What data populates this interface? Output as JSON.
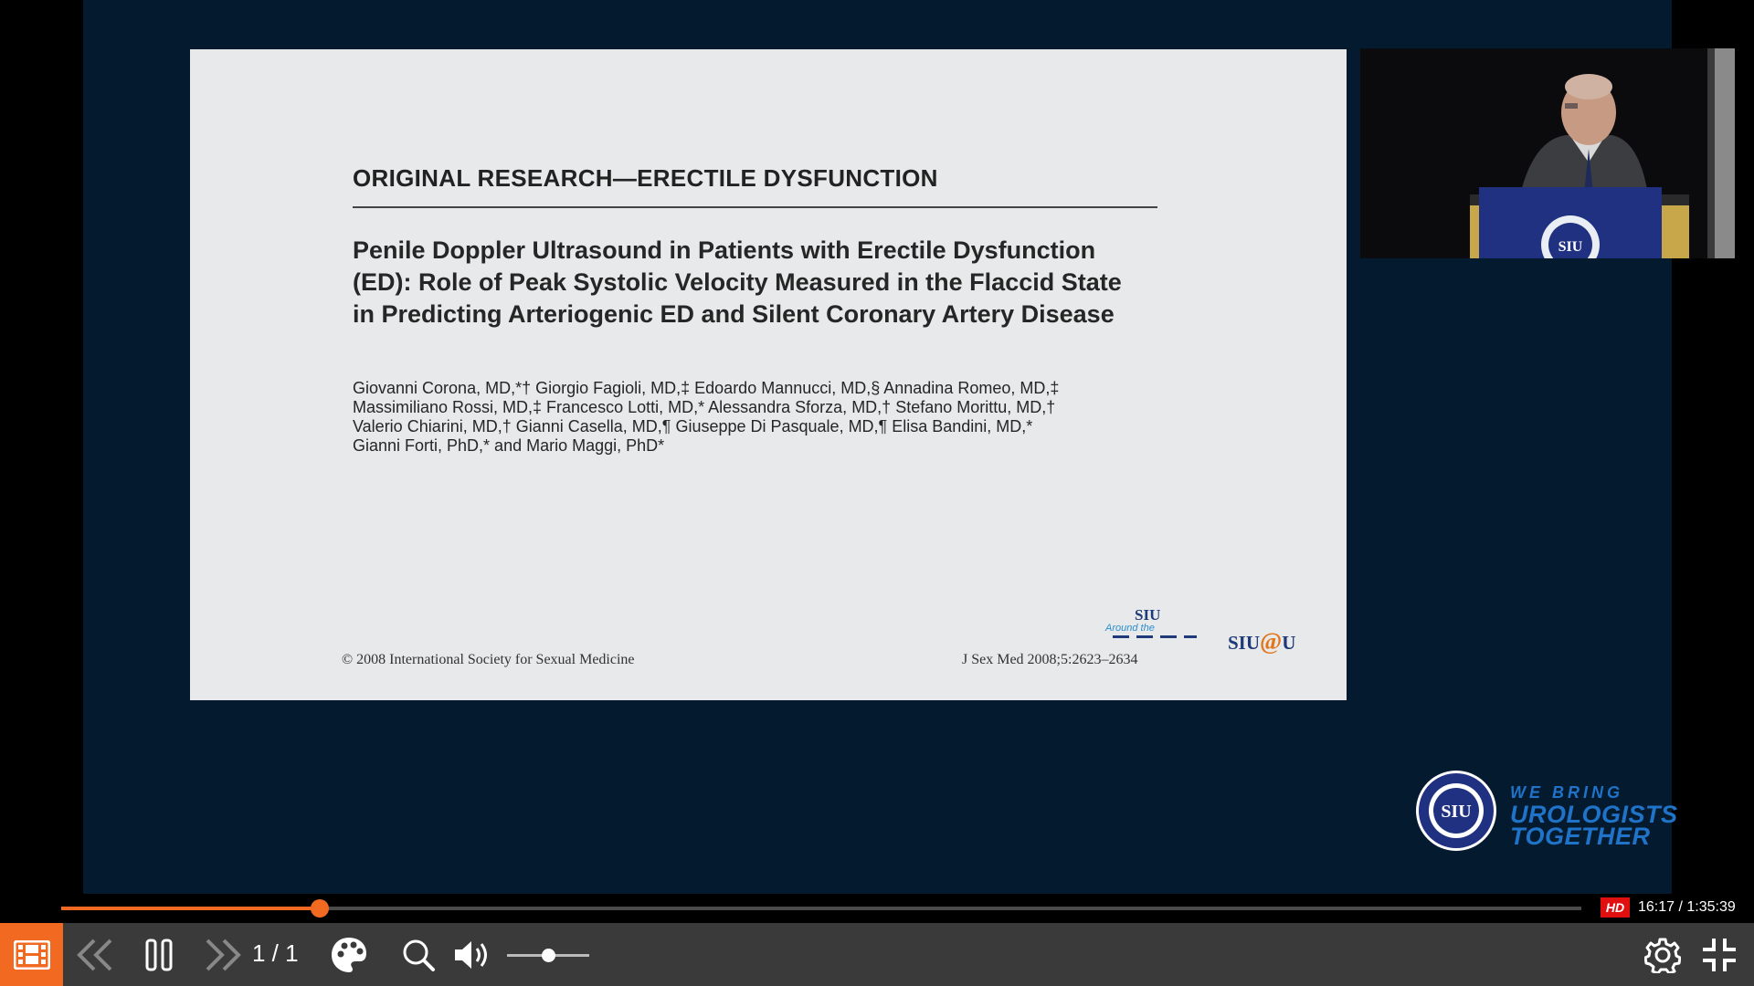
{
  "slide": {
    "category": "ORIGINAL RESEARCH—ERECTILE DYSFUNCTION",
    "title_lines": [
      "Penile Doppler Ultrasound in Patients with Erectile Dysfunction",
      "(ED): Role of Peak Systolic Velocity Measured in the Flaccid State",
      "in Predicting Arteriogenic ED and Silent Coronary Artery Disease"
    ],
    "author_lines": [
      "Giovanni Corona, MD,*† Giorgio Fagioli, MD,‡ Edoardo Mannucci, MD,§ Annadina Romeo, MD,‡",
      "Massimiliano Rossi, MD,‡ Francesco Lotti, MD,* Alessandra Sforza, MD,† Stefano Morittu, MD,†",
      "Valerio Chiarini, MD,† Gianni Casella, MD,¶ Giuseppe Di Pasquale, MD,¶ Elisa Bandini, MD,*",
      "Gianni Forti, PhD,* and Mario Maggi, PhD*"
    ],
    "copyright": "© 2008 International Society for Sexual Medicine",
    "citation": "J Sex Med 2008;5:2623–2634",
    "logo_siu_around": {
      "siu": "SIU",
      "around": "Around the"
    },
    "logo_siu_at_u": {
      "left": "SIU",
      "at": "@",
      "right": "U"
    }
  },
  "speaker_video": {
    "podium_seal": "SIU"
  },
  "brand": {
    "seal": "SIU",
    "line1": "WE BRING",
    "line2": "UROLOGISTS",
    "line3": "TOGETHER"
  },
  "player": {
    "progress_fraction": 0.17,
    "hd_label": "HD",
    "time": "16:17 / 1:35:39",
    "page_count": "1 / 1",
    "volume_fraction": 0.5,
    "accent_color": "#f26a21",
    "icons": [
      "playlist-icon",
      "previous-icon",
      "pause-icon",
      "next-icon",
      "palette-icon",
      "zoom-icon",
      "volume-icon",
      "settings-icon",
      "exit-fullscreen-icon"
    ]
  }
}
